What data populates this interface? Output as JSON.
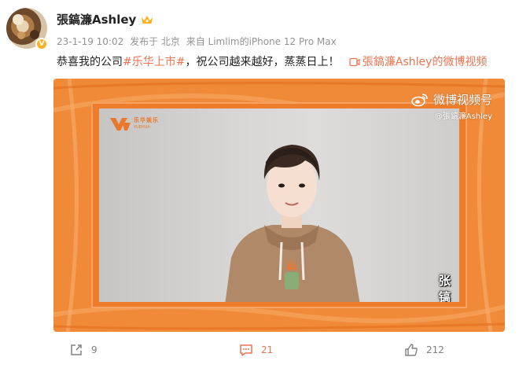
{
  "user": {
    "name": "張鎬濂Ashley",
    "verified_badge": "V"
  },
  "meta": {
    "time": "23-1-19 10:02",
    "location": "发布于 北京",
    "source": "来自 Limlim的iPhone 12 Pro Max"
  },
  "post": {
    "text_before": "恭喜我的公司",
    "hashtag": "#乐华上市#",
    "text_after": "，祝公司越来越好，蒸蒸日上！",
    "video_link": "張鎬濂Ashley的微博视频"
  },
  "video": {
    "watermark_title": "微博视频号",
    "watermark_handle": "@張鎬濂Ashley",
    "caption": "张镐濂",
    "brand_text": "乐华娱乐",
    "brand_subtext": "YUEHUA"
  },
  "actions": {
    "repost_count": "9",
    "comment_count": "21",
    "like_count": "212"
  },
  "colors": {
    "accent": "#eb7350",
    "video_frame": "#f08a38",
    "meta_gray": "#939393"
  }
}
